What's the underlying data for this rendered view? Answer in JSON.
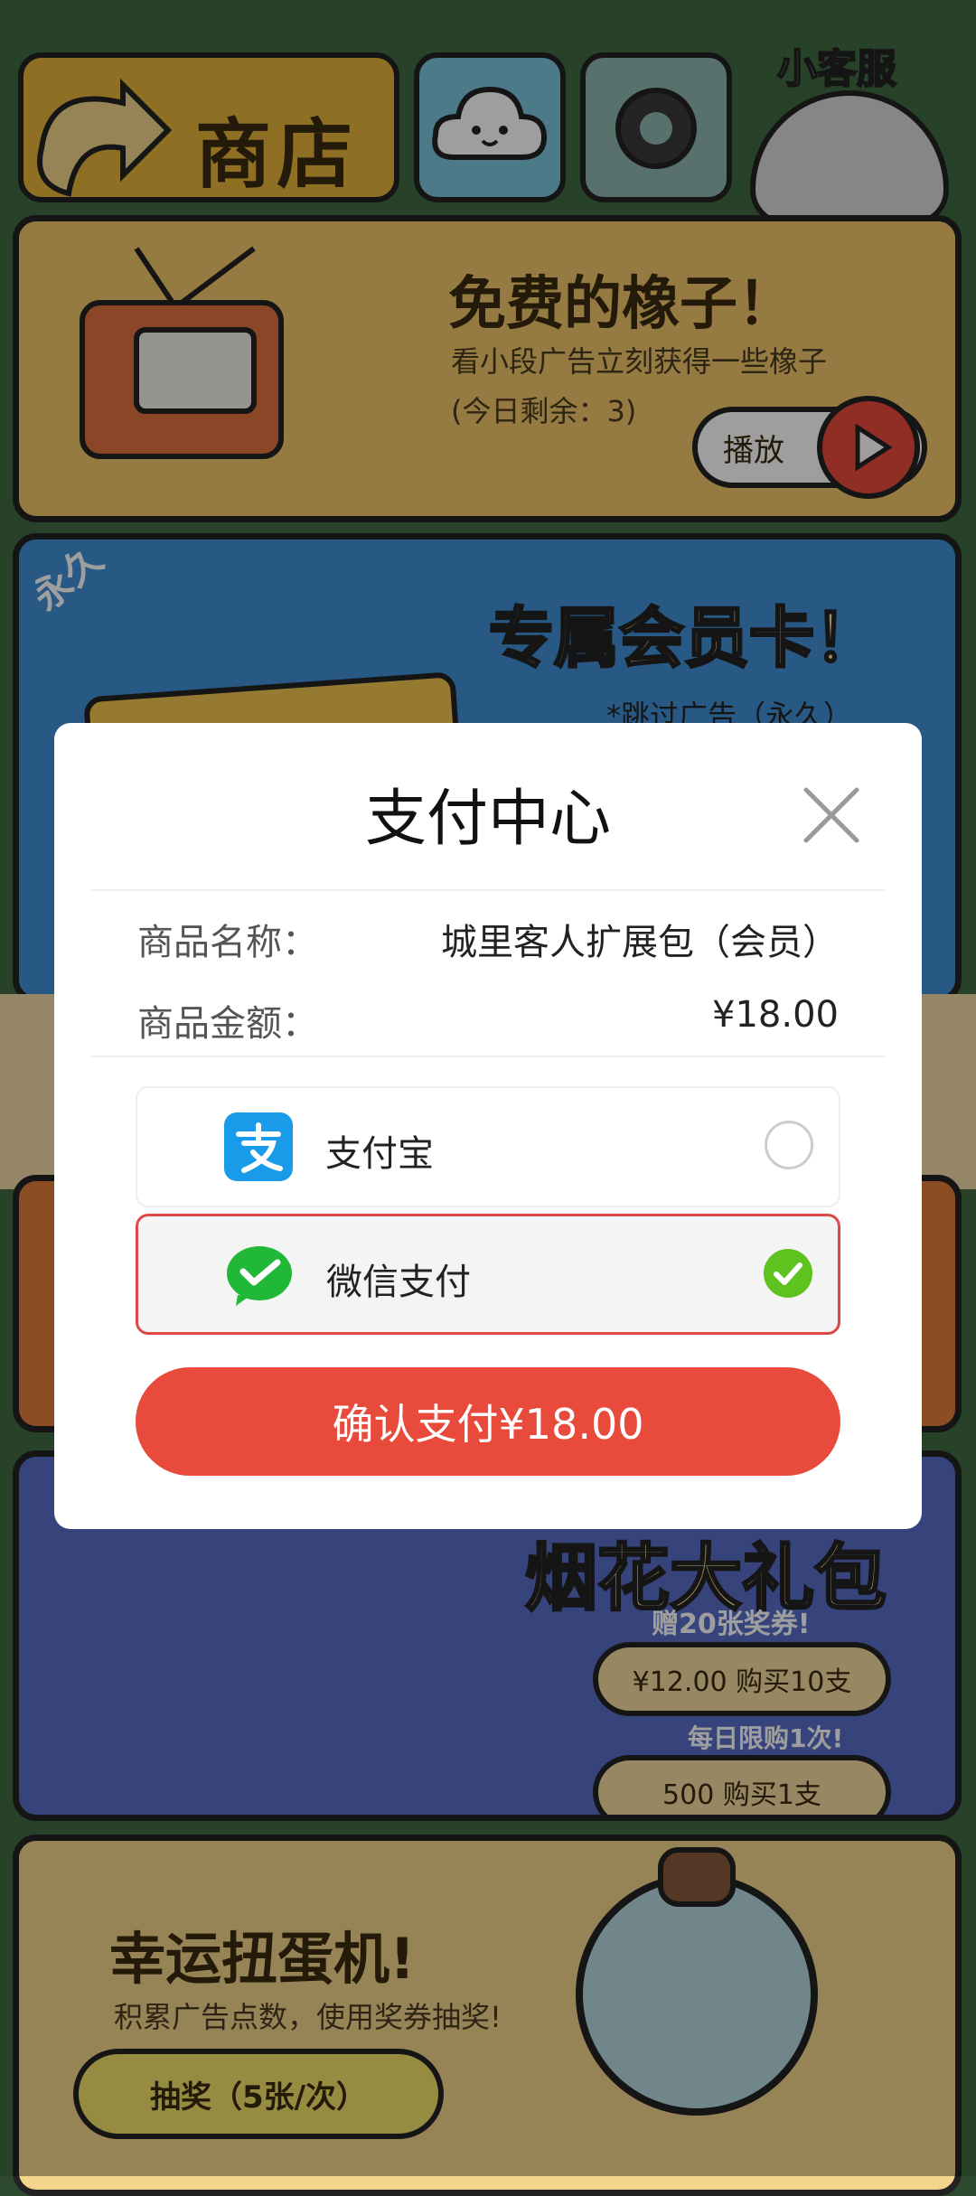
{
  "background": {
    "shop_label": "商店",
    "service_label": "小客服",
    "free_acorns": {
      "title": "免费的橡子！",
      "desc": "看小段广告立刻获得一些橡子",
      "remaining": "(今日剩余：3)",
      "play_label": "播放"
    },
    "member_card": {
      "badge": "永久",
      "title": "专属会员卡！",
      "note": "*跳过广告（永久）"
    },
    "fireworks": {
      "title": "烟花大礼包",
      "bonus_badge": "赠20张奖券!",
      "buy_10_label": "¥12.00 购买10支",
      "daily_badge": "每日限购1次!",
      "buy_1_label": "500 购买1支"
    },
    "gacha": {
      "title": "幸运扭蛋机!",
      "desc": "积累广告点数，使用奖券抽奖!",
      "draw_label": "抽奖（5张/次）"
    }
  },
  "dialog": {
    "title": "支付中心",
    "product_name_label": "商品名称：",
    "product_name_value": "城里客人扩展包（会员）",
    "amount_label": "商品金额：",
    "amount_value": "¥18.00",
    "methods": [
      {
        "name": "支付宝",
        "icon": "alipay-icon",
        "selected": false,
        "color": "#1a9bea"
      },
      {
        "name": "微信支付",
        "icon": "wechat-pay-icon",
        "selected": true,
        "color": "#22b837"
      }
    ],
    "confirm_label": "确认支付¥18.00"
  },
  "colors": {
    "accent": "#e84b3c",
    "selected_check": "#5ec21f",
    "alipay": "#1a9bea",
    "wechat": "#22b837"
  }
}
